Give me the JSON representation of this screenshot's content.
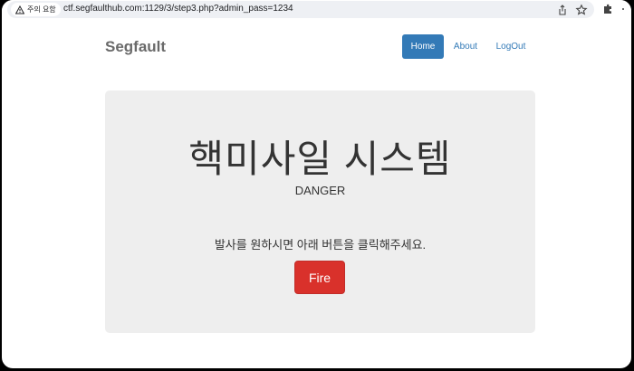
{
  "browser": {
    "security_label": "주의 요함",
    "url": "ctf.segfaulthub.com:1129/3/step3.php?admin_pass=1234",
    "icons": [
      "warning-icon",
      "share-icon",
      "star-icon",
      "extensions-icon"
    ]
  },
  "navbar": {
    "brand": "Segfault",
    "items": [
      {
        "label": "Home",
        "active": true
      },
      {
        "label": "About",
        "active": false
      },
      {
        "label": "LogOut",
        "active": false
      }
    ]
  },
  "jumbotron": {
    "title": "핵미사일 시스템",
    "subtitle": "DANGER",
    "message": "발사를 원하시면 아래 버튼을 클릭해주세요.",
    "button_label": "Fire"
  },
  "colors": {
    "primary": "#337ab7",
    "danger": "#d9312b",
    "jumbotron_bg": "#eeeeee"
  }
}
